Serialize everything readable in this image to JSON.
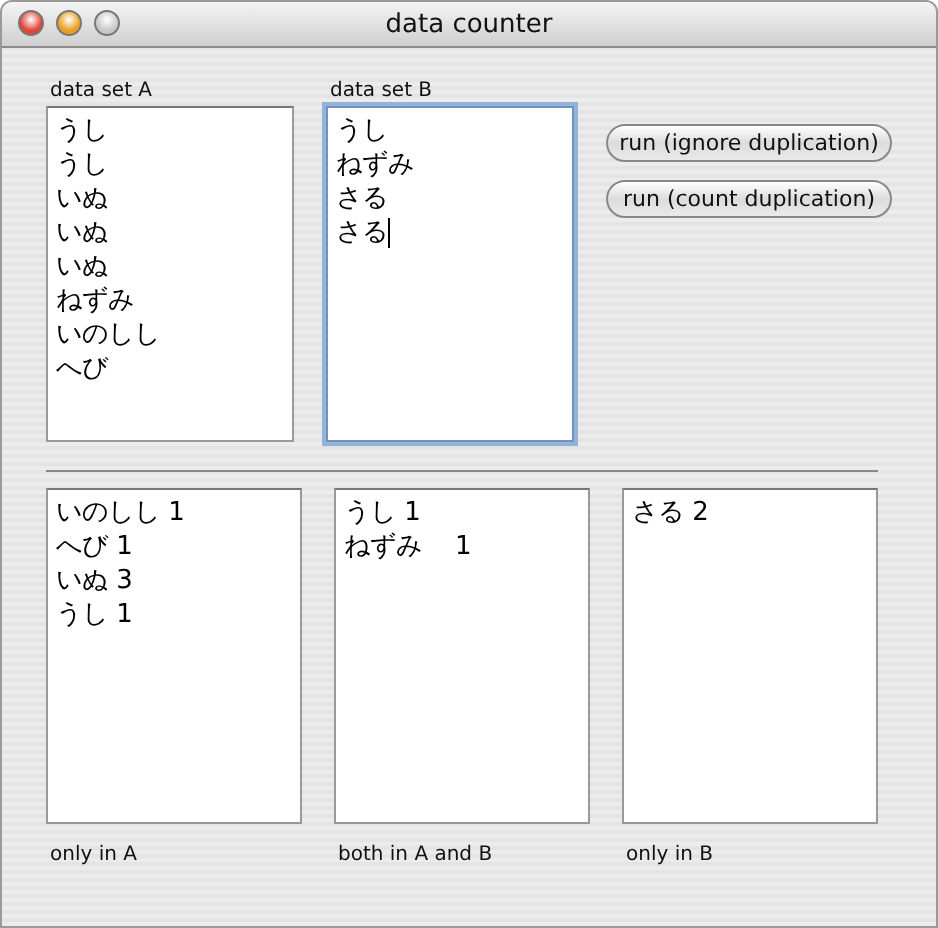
{
  "window": {
    "title": "data counter"
  },
  "inputs": [
    {
      "label": "data set A",
      "focused": false,
      "lines": [
        "うし",
        "うし",
        "いぬ",
        "いぬ",
        "いぬ",
        "ねずみ",
        "いのしし",
        "へび"
      ]
    },
    {
      "label": "data set B",
      "focused": true,
      "lines": [
        "うし",
        "ねずみ",
        "さる",
        "さる"
      ]
    }
  ],
  "buttons": [
    "run (ignore duplication)",
    "run (count duplication)"
  ],
  "results": [
    {
      "label": "only in A",
      "lines": [
        "いのしし 1",
        "へび 1",
        "いぬ 3",
        "うし 1"
      ]
    },
    {
      "label": "both in A and B",
      "lines": [
        "うし 1",
        "ねずみ    1"
      ]
    },
    {
      "label": "only in B",
      "lines": [
        "さる 2"
      ]
    }
  ]
}
